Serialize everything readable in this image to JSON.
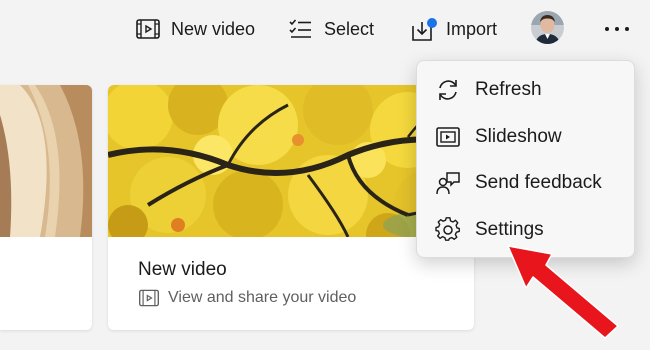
{
  "toolbar": {
    "new_video_label": "New video",
    "select_label": "Select",
    "import_label": "Import",
    "import_badge_color": "#1a73e8",
    "new_video_icon": "video-film-icon",
    "select_icon": "checklist-icon",
    "import_icon": "import-tray-icon",
    "more_icon": "more-ellipsis-icon"
  },
  "menu": {
    "items": [
      {
        "label": "Refresh",
        "icon": "refresh-icon"
      },
      {
        "label": "Slideshow",
        "icon": "slideshow-icon"
      },
      {
        "label": "Send feedback",
        "icon": "feedback-icon"
      },
      {
        "label": "Settings",
        "icon": "gear-icon"
      }
    ]
  },
  "cards": {
    "main": {
      "title": "New video",
      "subtitle": "View and share your video",
      "subtitle_icon": "video-film-icon"
    }
  },
  "annotation": {
    "arrow_color": "#e8161c"
  }
}
